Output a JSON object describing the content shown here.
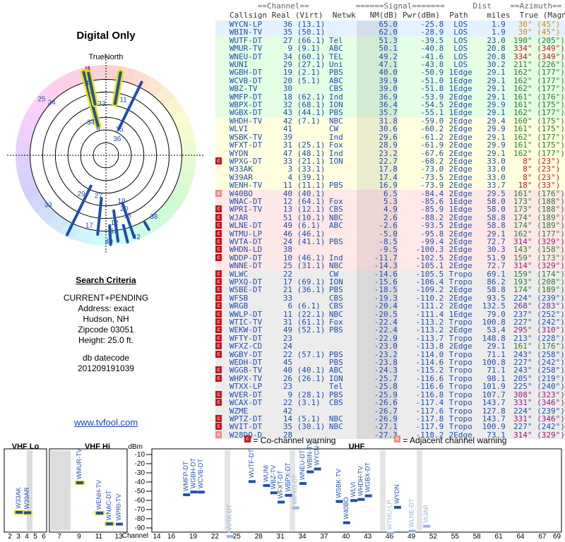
{
  "page": {
    "title": "Digital Only",
    "north_label": "TrueNorth",
    "compass_n": "N",
    "link": "www.tvfool.com"
  },
  "search": {
    "heading": "Search Criteria",
    "lines": [
      "CURRENT+PENDING",
      "Address: exact",
      "Hudson, NH",
      "Zipcode 03051",
      "Height: 25.0 ft."
    ]
  },
  "db": {
    "label": "db datecode",
    "value": "201209191039"
  },
  "table_headers": {
    "group_row": "      ==Channel==          ======Signal=======      Dist    ==Azimuth==",
    "column_row": "Callsign Real (Virt)  Netwk   NM(dB) Pwr(dBm)  Path    miles  True (Magn)"
  },
  "stations": [
    [
      "",
      "WYCN-LP",
      "36",
      "(13.1)",
      "",
      "65.0",
      "-25.8",
      "LOS",
      "1.9",
      "30°",
      "(45°)",
      "#d88a00",
      0
    ],
    [
      "",
      "WBIN-TV",
      "35",
      "(50.1)",
      "",
      "62.0",
      "-28.9",
      "LOS",
      "1.9",
      "30°",
      "(45°)",
      "#d88a00",
      0
    ],
    [
      "",
      "WUTF-DT",
      "27",
      "(66.1)",
      "Tel",
      "51.3",
      "-39.5",
      "LOS",
      "23.0",
      "190°",
      "(205°)",
      "#2a7a2a",
      1
    ],
    [
      "",
      "WMUR-TV",
      "9",
      "(9.1)",
      "ABC",
      "50.1",
      "-40.8",
      "LOS",
      "20.8",
      "334°",
      "(349°)",
      "#c4161c",
      1
    ],
    [
      "",
      "WNEU-DT",
      "34",
      "(60.1)",
      "TEL",
      "49.2",
      "-41.6",
      "LOS",
      "20.8",
      "334°",
      "(349°)",
      "#c4161c",
      1
    ],
    [
      "",
      "WUNI",
      "29",
      "(27.1)",
      "Uni",
      "47.1",
      "-43.8",
      "LOS",
      "30.2",
      "211°",
      "(226°)",
      "#2a7a2a",
      1
    ],
    [
      "",
      "WGBH-DT",
      "19",
      "(2.1)",
      "PBS",
      "40.0",
      "-50.9",
      "1Edge",
      "29.1",
      "162°",
      "(177°)",
      "#2a7a2a",
      1
    ],
    [
      "",
      "WCVB-DT",
      "20",
      "(5.1)",
      "ABC",
      "39.9",
      "-51.0",
      "1Edge",
      "29.1",
      "162°",
      "(177°)",
      "#2a7a2a",
      1
    ],
    [
      "",
      "WBZ-TV",
      "30",
      "",
      "CBS",
      "39.0",
      "-51.8",
      "1Edge",
      "29.1",
      "162°",
      "(177°)",
      "#2a7a2a",
      1
    ],
    [
      "",
      "WMFP-DT",
      "18",
      "(62.1)",
      "Ind",
      "36.9",
      "-53.9",
      "2Edge",
      "29.1",
      "161°",
      "(176°)",
      "#2a7a2a",
      1
    ],
    [
      "",
      "WBPX-DT",
      "32",
      "(68.1)",
      "ION",
      "36.4",
      "-54.5",
      "2Edge",
      "29.9",
      "161°",
      "(175°)",
      "#2a7a2a",
      1
    ],
    [
      "",
      "WGBX-DT",
      "43",
      "(44.1)",
      "PBS",
      "35.7",
      "-55.1",
      "1Edge",
      "29.1",
      "162°",
      "(177°)",
      "#2a7a2a",
      1
    ],
    [
      "",
      "WHDH-TV",
      "42",
      "(7.1)",
      "NBC",
      "31.8",
      "-59.0",
      "2Edge",
      "29.4",
      "160°",
      "(175°)",
      "#2a7a2a",
      2
    ],
    [
      "",
      "WLVI",
      "41",
      "",
      "CW",
      "30.6",
      "-60.2",
      "2Edge",
      "29.9",
      "161°",
      "(175°)",
      "#2a7a2a",
      2
    ],
    [
      "",
      "WSBK-TV",
      "39",
      "",
      "Ind",
      "29.6",
      "-61.2",
      "2Edge",
      "29.1",
      "162°",
      "(177°)",
      "#2a7a2a",
      2
    ],
    [
      "",
      "WFXT-DT",
      "31",
      "(25.1)",
      "Fox",
      "28.9",
      "-61.9",
      "2Edge",
      "29.9",
      "161°",
      "(175°)",
      "#2a7a2a",
      2
    ],
    [
      "",
      "WYDN",
      "47",
      "(48.1)",
      "Ind",
      "23.2",
      "-67.6",
      "2Edge",
      "29.1",
      "162°",
      "(177°)",
      "#2a7a2a",
      2
    ],
    [
      "c",
      "WPXG-DT",
      "33",
      "(21.1)",
      "ION",
      "22.7",
      "-68.2",
      "2Edge",
      "33.0",
      "8°",
      "(23°)",
      "#c4161c",
      2
    ],
    [
      "",
      "W33AK",
      "3",
      "(33.1)",
      "",
      "17.8",
      "-73.0",
      "2Edge",
      "33.0",
      "8°",
      "(23°)",
      "#c4161c",
      2
    ],
    [
      "",
      "W39AR",
      "4",
      "(39.1)",
      "",
      "17.4",
      "-73.5",
      "2Edge",
      "33.0",
      "8°",
      "(23°)",
      "#c4161c",
      2
    ],
    [
      "",
      "WENH-TV",
      "11",
      "(11.1)",
      "PBS",
      "16.9",
      "-73.9",
      "2Edge",
      "33.7",
      "18°",
      "(33°)",
      "#c4161c",
      2
    ],
    [
      "a",
      "W40BO",
      "40",
      "(40.1)",
      "",
      "6.5",
      "-84.4",
      "2Edge",
      "29.5",
      "161°",
      "(176°)",
      "#2a7a2a",
      3
    ],
    [
      "",
      "WNAC-DT",
      "12",
      "(64.1)",
      "Fox",
      "5.3",
      "-85.6",
      "1Edge",
      "58.0",
      "173°",
      "(188°)",
      "#2a7a2a",
      3
    ],
    [
      "c",
      "WPRI-TV",
      "13",
      "(12.1)",
      "CBS",
      "4.9",
      "-85.9",
      "1Edge",
      "58.0",
      "173°",
      "(188°)",
      "#2a7a2a",
      3
    ],
    [
      "c",
      "WJAR",
      "51",
      "(10.1)",
      "NBC",
      "2.6",
      "-88.2",
      "2Edge",
      "58.8",
      "174°",
      "(189°)",
      "#2a7a2a",
      3
    ],
    [
      "c",
      "WLNE-DT",
      "49",
      "(6.1)",
      "ABC",
      "-2.6",
      "-93.5",
      "2Edge",
      "58.8",
      "174°",
      "(189°)",
      "#2a7a2a",
      3
    ],
    [
      "c",
      "WTMU-LP",
      "46",
      "(46.1)",
      "",
      "-5.0",
      "-95.8",
      "2Edge",
      "29.1",
      "162°",
      "(177°)",
      "#2a7a2a",
      3
    ],
    [
      "c",
      "WVTA-DT",
      "24",
      "(41.1)",
      "PBS",
      "-8.5",
      "-99.4",
      "2Edge",
      "72.7",
      "314°",
      "(329°)",
      "#9a1a7a",
      3
    ],
    [
      "c",
      "WHDN-LD",
      "38",
      "",
      "",
      "-9.5",
      "-100.3",
      "2Edge",
      "30.3",
      "143°",
      "(158°)",
      "#2a7a2a",
      3
    ],
    [
      "c",
      "WDDP-DT",
      "10",
      "(46.1)",
      "Ind",
      "-11.7",
      "-102.5",
      "2Edge",
      "51.9",
      "159°",
      "(173°)",
      "#2a7a2a",
      3
    ],
    [
      "",
      "WNNE-DT",
      "25",
      "(31.1)",
      "NBC",
      "-14.3",
      "-105.1",
      "2Edge",
      "72.7",
      "314°",
      "(329°)",
      "#9a1a7a",
      3
    ],
    [
      "c",
      "WLWC",
      "22",
      "",
      "CW",
      "-14.6",
      "-105.5",
      "Tropo",
      "69.1",
      "159°",
      "(174°)",
      "#2a7a2a",
      4
    ],
    [
      "c",
      "WPXQ-DT",
      "17",
      "(69.1)",
      "ION",
      "-15.6",
      "-106.4",
      "Tropo",
      "86.2",
      "193°",
      "(208°)",
      "#2a7a2a",
      4
    ],
    [
      "c",
      "WSBE-DT",
      "21",
      "(36.1)",
      "PBS",
      "-18.5",
      "-109.2",
      "2Edge",
      "58.8",
      "174°",
      "(189°)",
      "#2a7a2a",
      4
    ],
    [
      "c",
      "WFSB",
      "33",
      "",
      "CBS",
      "-19.3",
      "-110.2",
      "2Edge",
      "93.5",
      "224°",
      "(239°)",
      "#1f4fb0",
      4
    ],
    [
      "c",
      "WRGB",
      "6",
      "(6.1)",
      "CBS",
      "-20.4",
      "-111.2",
      "2Edge",
      "132.5",
      "268°",
      "(283°)",
      "#6a2aa0",
      4
    ],
    [
      "c",
      "WWLP-DT",
      "11",
      "(22.1)",
      "NBC",
      "-20.5",
      "-111.4",
      "1Edge",
      "79.0",
      "237°",
      "(252°)",
      "#1f4fb0",
      4
    ],
    [
      "c",
      "WTIC-TV",
      "31",
      "(61.1)",
      "Fox",
      "-22.4",
      "-113.2",
      "Tropo",
      "100.8",
      "227°",
      "(242°)",
      "#1f4fb0",
      4
    ],
    [
      "c",
      "WEKW-DT",
      "49",
      "(52.1)",
      "PBS",
      "-22.4",
      "-113.2",
      "2Edge",
      "53.4",
      "295°",
      "(310°)",
      "#9a1a7a",
      4
    ],
    [
      "c",
      "WFTY-DT",
      "23",
      "",
      "",
      "-22.9",
      "-113.7",
      "Tropo",
      "148.8",
      "213°",
      "(228°)",
      "#1f4fb0",
      4
    ],
    [
      "c",
      "WFXZ-CD",
      "24",
      "",
      "",
      "-23.0",
      "-113.8",
      "2Edge",
      "29.1",
      "161°",
      "(176°)",
      "#2a7a2a",
      4
    ],
    [
      "c",
      "WGBY-DT",
      "22",
      "(57.1)",
      "PBS",
      "-23.2",
      "-114.0",
      "Tropo",
      "71.1",
      "243°",
      "(258°)",
      "#1f4fb0",
      4
    ],
    [
      "",
      "WEDH-DT",
      "45",
      "",
      "PBS",
      "-23.8",
      "-114.6",
      "Tropo",
      "100.8",
      "227°",
      "(242°)",
      "#1f4fb0",
      4
    ],
    [
      "c",
      "WGGB-TV",
      "40",
      "(40.1)",
      "ABC",
      "-24.3",
      "-115.2",
      "Tropo",
      "71.1",
      "243°",
      "(258°)",
      "#1f4fb0",
      4
    ],
    [
      "c",
      "WHPX-TV",
      "26",
      "(26.1)",
      "ION",
      "-25.7",
      "-116.6",
      "Tropo",
      "98.1",
      "205°",
      "(219°)",
      "#1f4fb0",
      4
    ],
    [
      "",
      "WTXX-LP",
      "23",
      "",
      "Tel",
      "-25.8",
      "-116.6",
      "Tropo",
      "101.9",
      "225°",
      "(240°)",
      "#1f4fb0",
      4
    ],
    [
      "c",
      "WVER-DT",
      "9",
      "(28.1)",
      "PBS",
      "-25.9",
      "-116.8",
      "Tropo",
      "107.7",
      "308°",
      "(323°)",
      "#9a1a7a",
      4
    ],
    [
      "c",
      "WCAX-DT",
      "22",
      "(3.1)",
      "CBS",
      "-26.6",
      "-117.4",
      "Tropo",
      "143.7",
      "331°",
      "(346°)",
      "#9a1a7a",
      4
    ],
    [
      "",
      "WZME",
      "42",
      "",
      "",
      "-26.7",
      "-117.6",
      "Tropo",
      "127.8",
      "224°",
      "(239°)",
      "#1f4fb0",
      4
    ],
    [
      "c",
      "WPTZ-DT",
      "14",
      "(5.1)",
      "NBC",
      "-26.9",
      "-117.8",
      "Tropo",
      "143.7",
      "331°",
      "(346°)",
      "#9a1a7a",
      4
    ],
    [
      "c",
      "WVIT-DT",
      "35",
      "(30.1)",
      "NBC",
      "-27.1",
      "-117.9",
      "Tropo",
      "100.9",
      "227°",
      "(242°)",
      "#1f4fb0",
      4
    ],
    [
      "a",
      "W28DQ-D",
      "28",
      "",
      "",
      "-27.3",
      "-118.2",
      "2Edge",
      "73.1",
      "314°",
      "(329°)",
      "#9a1a7a",
      4
    ]
  ],
  "legend": {
    "cochannel": "= Co-channel warning",
    "adjacent": "= Adjacent channel warning",
    "c": "c",
    "a": "a"
  },
  "radar": {
    "stations": [
      {
        "label": "4",
        "az": -15,
        "r": 0.8
      },
      {
        "label": "3",
        "az": -13,
        "r": 0.7
      },
      {
        "label": "11",
        "az": 18,
        "r": 0.62
      },
      {
        "label": "33",
        "az": -5,
        "r": 0.55
      },
      {
        "label": "25",
        "az": -50,
        "r": 0.93
      },
      {
        "label": "24",
        "az": -47,
        "r": 0.82
      },
      {
        "label": "34",
        "az": -26,
        "r": 0.38
      },
      {
        "label": "9",
        "az": -18,
        "r": 0.28
      },
      {
        "label": "35",
        "az": 30,
        "r": 0.3
      },
      {
        "label": "36",
        "az": 38,
        "r": 0.2
      },
      {
        "label": "29",
        "az": 211,
        "r": 0.53
      },
      {
        "label": "27",
        "az": 190,
        "r": 0.48
      },
      {
        "label": "33",
        "az": 228,
        "r": 0.86
      },
      {
        "label": "19",
        "az": 162,
        "r": 0.56
      },
      {
        "label": "20",
        "az": 162,
        "r": 0.65
      },
      {
        "label": "18",
        "az": 161,
        "r": 0.73
      },
      {
        "label": "38",
        "az": 143,
        "r": 0.88
      },
      {
        "label": "12",
        "az": 173,
        "r": 0.78
      },
      {
        "label": "13",
        "az": 174,
        "r": 0.87
      },
      {
        "label": "17",
        "az": 193,
        "r": 0.82
      },
      {
        "label": "49",
        "az": 178,
        "r": 0.98
      },
      {
        "label": "42",
        "az": 160,
        "r": 0.99
      }
    ]
  },
  "chart": {
    "dbm_label": "dBm",
    "channel_label": "Channel",
    "vhf_lo": "VHF Lo",
    "vhf_hi": "VHF Hi",
    "uhf": "UHF",
    "yticks": [
      -10,
      -20,
      -30,
      -40,
      -50,
      -60,
      -70,
      -80,
      -90
    ],
    "vhf_lo_ticks": [
      "2",
      "3",
      "4",
      "5",
      "6"
    ],
    "vhf_hi_ticks": [
      "7",
      "9",
      "11",
      "13"
    ],
    "uhf_ticks": [
      "14",
      "16",
      "19",
      "22",
      "25",
      "28",
      "31",
      "34",
      "37",
      "40",
      "43",
      "46",
      "49",
      "52",
      "55",
      "58",
      "61",
      "64",
      "67",
      "69"
    ],
    "bars": [
      {
        "name": "W33AK",
        "ch": 3,
        "dbm": -73.0,
        "band": "lo",
        "hi": 1
      },
      {
        "name": "W39AR",
        "ch": 4,
        "dbm": -73.5,
        "band": "lo",
        "hi": 1
      },
      {
        "name": "WMUR-TV",
        "ch": 9,
        "dbm": -40.8,
        "band": "hi",
        "hi": 1
      },
      {
        "name": "WENH-TV",
        "ch": 11,
        "dbm": -73.9,
        "band": "hi",
        "hi": 1
      },
      {
        "name": "WNAC-DT",
        "ch": 12,
        "dbm": -85.6,
        "band": "hi",
        "hi": 1
      },
      {
        "name": "WPRI-TV",
        "ch": 13,
        "dbm": -85.9,
        "band": "hi",
        "hi": 0
      },
      {
        "name": "WMFP-DT",
        "ch": 18,
        "dbm": -53.9,
        "band": "u",
        "hi": 0
      },
      {
        "name": "WGBH-DT",
        "ch": 19,
        "dbm": -50.9,
        "band": "u",
        "hi": 0
      },
      {
        "name": "WCVB-DT",
        "ch": 20,
        "dbm": -51.0,
        "band": "u",
        "hi": 0
      },
      {
        "name": "WVTA-DT",
        "ch": 24,
        "dbm": -99.4,
        "band": "u",
        "hi": 0,
        "weak": 1
      },
      {
        "name": "WUTF-DT",
        "ch": 27,
        "dbm": -39.5,
        "band": "u",
        "hi": 0
      },
      {
        "name": "WUNI",
        "ch": 29,
        "dbm": -43.8,
        "band": "u",
        "hi": 0
      },
      {
        "name": "WBZ-TV",
        "ch": 30,
        "dbm": -51.8,
        "band": "u",
        "hi": 0
      },
      {
        "name": "WFXT-DT",
        "ch": 31,
        "dbm": -61.9,
        "band": "u",
        "hi": 0
      },
      {
        "name": "WBPX-DT",
        "ch": 32,
        "dbm": -54.5,
        "band": "u",
        "hi": 0
      },
      {
        "name": "WPXG-DT",
        "ch": 33,
        "dbm": -68.2,
        "band": "u",
        "hi": 0,
        "weak": 1
      },
      {
        "name": "WNEU-DT",
        "ch": 34,
        "dbm": -41.6,
        "band": "u",
        "hi": 0
      },
      {
        "name": "WBIN-TV",
        "ch": 35,
        "dbm": -28.9,
        "band": "u",
        "hi": 0
      },
      {
        "name": "WYCN-LP",
        "ch": 36,
        "dbm": -25.8,
        "band": "u",
        "hi": 0
      },
      {
        "name": "WSBK-TV",
        "ch": 39,
        "dbm": -61.2,
        "band": "u",
        "hi": 0
      },
      {
        "name": "W40BO",
        "ch": 40,
        "dbm": -84.4,
        "band": "u",
        "hi": 0
      },
      {
        "name": "WLVI",
        "ch": 41,
        "dbm": -60.2,
        "band": "u",
        "hi": 0
      },
      {
        "name": "WHDH-TV",
        "ch": 42,
        "dbm": -59.0,
        "band": "u",
        "hi": 0
      },
      {
        "name": "WGBX-DT",
        "ch": 43,
        "dbm": -55.1,
        "band": "u",
        "hi": 0
      },
      {
        "name": "WTMU-LP",
        "ch": 46,
        "dbm": -95.8,
        "band": "u",
        "hi": 0,
        "weak": 1
      },
      {
        "name": "WYDN",
        "ch": 47,
        "dbm": -67.6,
        "band": "u",
        "hi": 0
      },
      {
        "name": "WLNE-DT",
        "ch": 49,
        "dbm": -93.5,
        "band": "u",
        "hi": 0,
        "weak": 1
      },
      {
        "name": "WJAR",
        "ch": 51,
        "dbm": -88.2,
        "band": "u",
        "hi": 0,
        "weak": 1
      }
    ]
  }
}
